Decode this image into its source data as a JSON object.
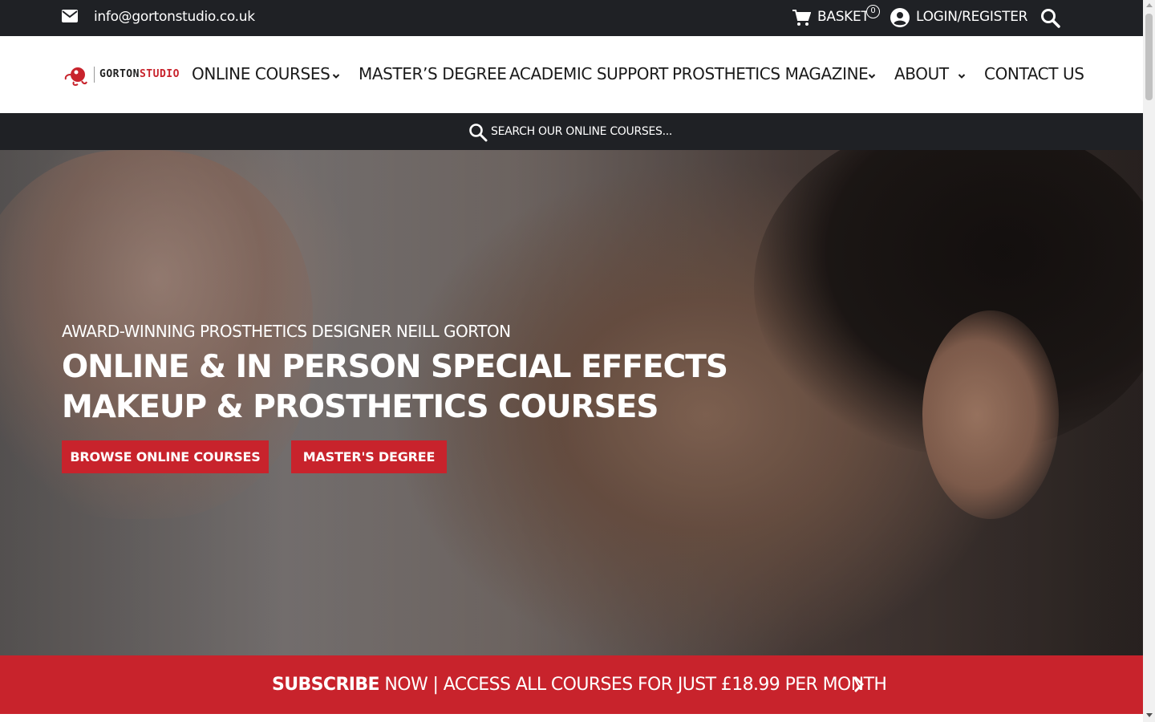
{
  "topbar": {
    "email": "info@gortonstudio.co.uk",
    "basket_label": "BASKET",
    "basket_count": "0",
    "login_label": "LOGIN/REGISTER"
  },
  "logo": {
    "part1": "GORTON",
    "part2": "STUDIO"
  },
  "nav": {
    "items": [
      {
        "label": "ONLINE COURSES",
        "has_dropdown": true
      },
      {
        "label": "MASTER’S DEGREE",
        "has_dropdown": false
      },
      {
        "label": "ACADEMIC SUPPORT",
        "has_dropdown": false
      },
      {
        "label": "PROSTHETICS MAGAZINE",
        "has_dropdown": true
      },
      {
        "label": "ABOUT",
        "has_dropdown": true
      },
      {
        "label": "CONTACT US",
        "has_dropdown": false
      }
    ]
  },
  "search": {
    "placeholder": "SEARCH OUR ONLINE COURSES..."
  },
  "hero": {
    "kicker": "AWARD-WINNING PROSTHETICS DESIGNER NEILL GORTON",
    "headline_line1": "ONLINE & IN PERSON SPECIAL EFFECTS",
    "headline_line2": "MAKEUP & PROSTHETICS COURSES",
    "button_primary": "BROWSE ONLINE COURSES",
    "button_secondary": "MASTER'S DEGREE"
  },
  "subscribe": {
    "bold": "SUBSCRIBE",
    "rest": " NOW | ACCESS ALL COURSES FOR JUST £18.99 PER MONTH"
  },
  "colors": {
    "accent": "#c8232c",
    "dark": "#1f2125"
  },
  "icons": [
    "mail-icon",
    "cart-icon",
    "user-icon",
    "search-icon",
    "chevron-down-icon",
    "chevron-right-icon",
    "logo-mark-icon"
  ]
}
